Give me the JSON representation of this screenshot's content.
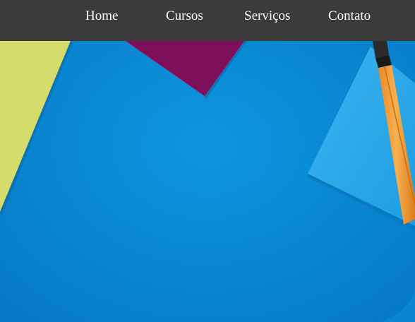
{
  "nav": {
    "items": [
      {
        "label": "Home"
      },
      {
        "label": "Cursos"
      },
      {
        "label": "Serviços"
      },
      {
        "label": "Contato"
      }
    ]
  },
  "colors": {
    "navbar_bg": "#3b3b3b",
    "nav_text": "#ffffff",
    "background_blue": "#0a8ad6",
    "paper_yellow": "#d6dc6c",
    "paper_purple": "#7d0f5a",
    "paper_light_blue": "#29a6e8",
    "pencil_orange": "#f4a042"
  },
  "hero": {
    "image": "colorful-paper-background"
  }
}
